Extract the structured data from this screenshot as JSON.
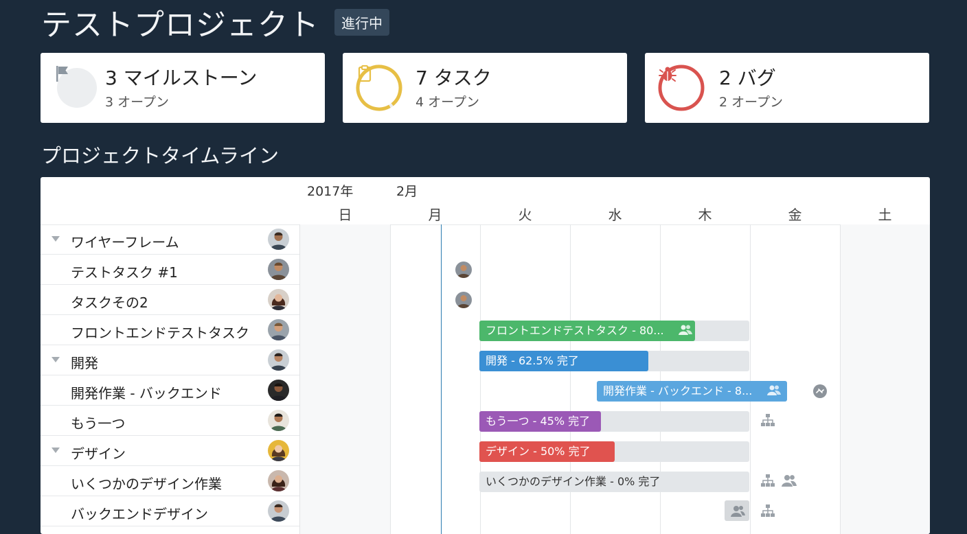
{
  "project": {
    "title": "テストプロジェクト",
    "status": "進行中"
  },
  "cards": [
    {
      "title": "3 マイルストーン",
      "sub": "3 オープン",
      "icon": "flag-icon",
      "color": "#8c96a0",
      "progress": 0.0
    },
    {
      "title": "7 タスク",
      "sub": "4 オープン",
      "icon": "clipboard-icon",
      "color": "#e7bf45",
      "progress": 1.0
    },
    {
      "title": "2 バグ",
      "sub": "2 オープン",
      "icon": "bug-icon",
      "color": "#d9534f",
      "progress": 1.0
    }
  ],
  "timeline": {
    "title": "プロジェクトタイムライン",
    "year": "2017年",
    "month": "2月",
    "days": [
      "日",
      "月",
      "火",
      "水",
      "木",
      "金",
      "土"
    ],
    "tasks": [
      {
        "name": "ワイヤーフレーム",
        "group": true
      },
      {
        "name": "テストタスク #1",
        "group": false
      },
      {
        "name": "タスクその2",
        "group": false
      },
      {
        "name": "フロントエンドテストタスク",
        "group": false
      },
      {
        "name": "開発",
        "group": true
      },
      {
        "name": "開発作業 - バックエンド",
        "group": false
      },
      {
        "name": "もう一つ",
        "group": false
      },
      {
        "name": "デザイン",
        "group": true
      },
      {
        "name": "いくつかのデザイン作業",
        "group": false
      },
      {
        "name": "バックエンドデザイン",
        "group": false
      }
    ],
    "bars": [
      {
        "label": "フロントエンドテストタスク - 80...",
        "progress": 0.8,
        "color": "#4cb76b"
      },
      {
        "label": "開発 - 62.5% 完了",
        "progress": 0.625,
        "color": "#3a8fd4"
      },
      {
        "label": "開発作業 - バックエンド - 8...",
        "progress": 0.8,
        "color": "#5aa6df"
      },
      {
        "label": "もう一つ - 45% 完了",
        "progress": 0.45,
        "color": "#9b59b6"
      },
      {
        "label": "デザイン - 50% 完了",
        "progress": 0.5,
        "color": "#e0534f"
      },
      {
        "label": "いくつかのデザイン作業 - 0% 完了",
        "progress": 0.0,
        "color": "#e3e6e9"
      }
    ]
  }
}
